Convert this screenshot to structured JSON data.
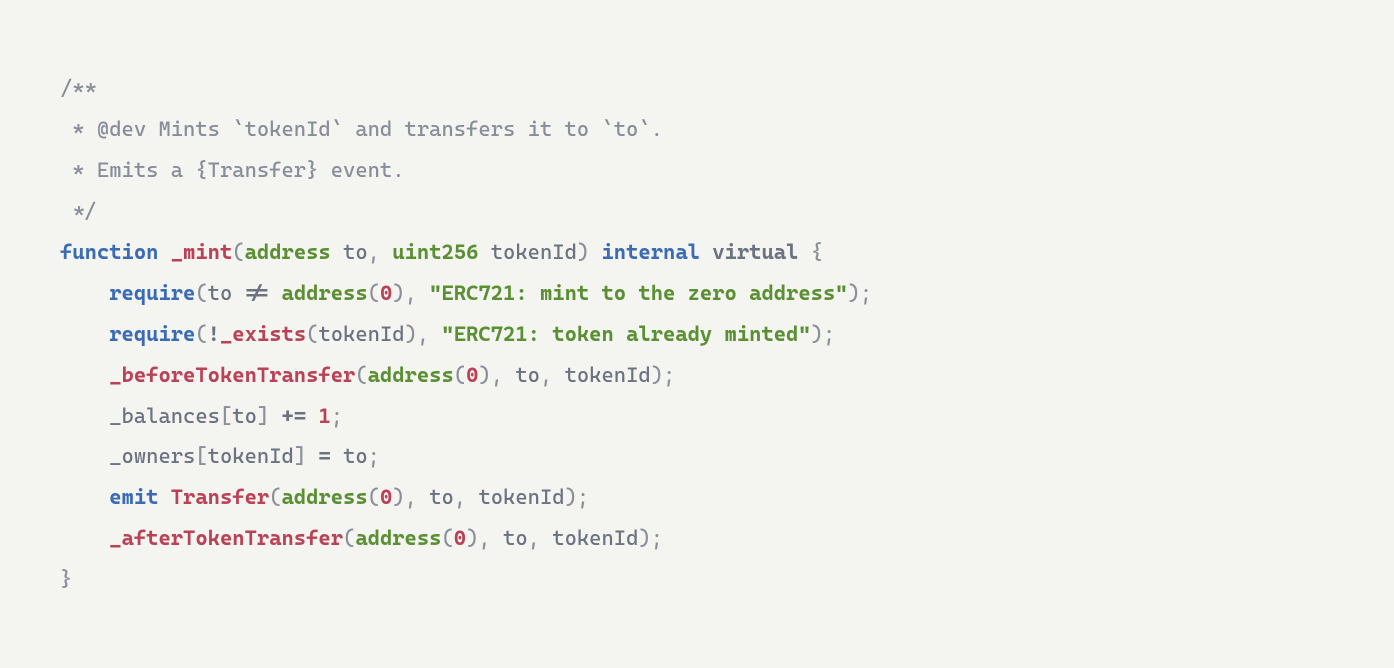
{
  "code": {
    "c1": "/**",
    "c2": " * @dev Mints `tokenId` and transfers it to `to`.",
    "c3": " * Emits a {Transfer} event.",
    "c4": " */",
    "k_function": "function",
    "fn_mint": "_mint",
    "lp": "(",
    "rp": ")",
    "t_address": "address",
    "p_to": "to",
    "comma": ",",
    "t_uint256": "uint256",
    "p_tokenId": "tokenId",
    "k_internal": "internal",
    "k_virtual": "virtual",
    "lbrace": "{",
    "rbrace": "}",
    "indent1": "    ",
    "call_require": "require",
    "op_ne": "!=",
    "num_0": "0",
    "str_mint_zero": "\"ERC721: mint to the zero address\"",
    "semi": ";",
    "op_not": "!",
    "fn_exists": "_exists",
    "str_already": "\"ERC721: token already minted\"",
    "fn_beforeTT": "_beforeTokenTransfer",
    "m_balances": "_balances",
    "lbrack": "[",
    "rbrack": "]",
    "op_pluseq": "+=",
    "num_1": "1",
    "m_owners": "_owners",
    "op_eq": "=",
    "k_emit": "emit",
    "fn_transfer": "Transfer",
    "fn_afterTT": "_afterTokenTransfer",
    "sp": " "
  }
}
